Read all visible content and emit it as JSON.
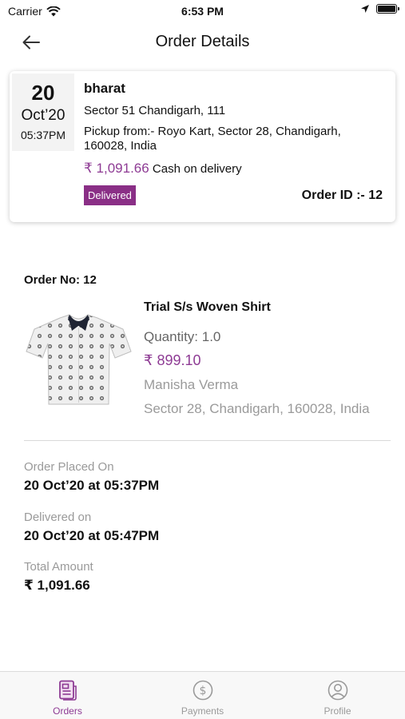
{
  "status_bar": {
    "carrier": "Carrier",
    "time": "6:53 PM"
  },
  "header": {
    "title": "Order Details"
  },
  "summary": {
    "day": "20",
    "month": "Oct’20",
    "time": "05:37PM",
    "customer_name": "bharat",
    "customer_address": "Sector 51 Chandigarh, 111",
    "pickup": "Pickup from:- Royo Kart, Sector 28, Chandigarh, 160028, India",
    "amount": "₹ 1,091.66",
    "payment_method": "Cash on delivery",
    "status": "Delivered",
    "order_id": "Order ID :- 12"
  },
  "order": {
    "order_no": "Order No: 12",
    "product_name": "Trial S/s Woven Shirt",
    "quantity": "Quantity: 1.0",
    "price": "₹ 899.10",
    "seller_name": "Manisha Verma",
    "seller_address": "Sector 28, Chandigarh, 160028, India"
  },
  "details": {
    "placed_label": "Order Placed On",
    "placed_value": "20 Oct’20 at 05:37PM",
    "delivered_label": "Delivered on",
    "delivered_value": "20 Oct’20 at 05:47PM",
    "total_label": "Total Amount",
    "total_value": "₹ 1,091.66"
  },
  "tabs": [
    {
      "label": "Orders",
      "icon": "orders-icon",
      "active": true
    },
    {
      "label": "Payments",
      "icon": "payments-icon",
      "active": false
    },
    {
      "label": "Profile",
      "icon": "profile-icon",
      "active": false
    }
  ],
  "colors": {
    "accent": "#8e3b94",
    "badge": "#8a2f86",
    "muted": "#9a9a9a"
  }
}
